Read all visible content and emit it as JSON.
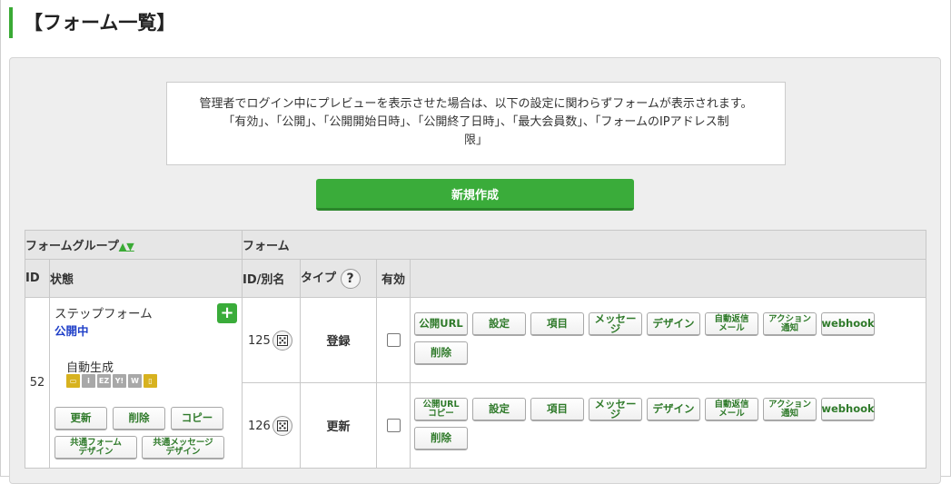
{
  "page": {
    "title": "【フォーム一覧】"
  },
  "notice": {
    "line1": "管理者でログイン中にプレビューを表示させた場合は、以下の設定に関わらずフォームが表示されます。",
    "line2": "「有効」、「公開」、「公開開始日時」、「公開終了日時」、「最大会員数」、「フォームのIPアドレス制",
    "line3": "限」"
  },
  "new_button": {
    "label": "新規作成"
  },
  "table": {
    "group_header": "フォームグループ",
    "sort_icon": "▲▼",
    "form_header": "フォーム",
    "columns": {
      "id": "ID",
      "status": "状態",
      "alias": "ID/別名",
      "type": "タイプ",
      "help": "?",
      "enabled": "有効"
    }
  },
  "group": {
    "id": "52",
    "name": "ステップフォーム",
    "status": "公開中",
    "add_icon": "+",
    "auto_label": "自動生成",
    "device_icons": [
      "pc-icon",
      "i-icon",
      "ez-icon",
      "yahoo-icon",
      "w-icon",
      "mobile-icon"
    ],
    "device_letters": [
      "▭",
      "i",
      "EZ",
      "Y!",
      "W",
      "▯"
    ],
    "buttons": {
      "update": "更新",
      "delete": "削除",
      "copy": "コピー",
      "common_form_design_1": "共通フォーム",
      "common_form_design_2": "デザイン",
      "common_msg_design_1": "共通メッセージ",
      "common_msg_design_2": "デザイン"
    }
  },
  "forms": [
    {
      "id": "125",
      "type": "登録",
      "enabled": false,
      "actions": {
        "public_url": "公開URL",
        "settings": "設定",
        "items": "項目",
        "message": "メッセージ",
        "design": "デザイン",
        "auto_reply_1": "自動返信",
        "auto_reply_2": "メール",
        "action_notice_1": "アクション",
        "action_notice_2": "通知",
        "webhook": "webhook",
        "delete": "削除"
      }
    },
    {
      "id": "126",
      "type": "更新",
      "enabled": false,
      "actions": {
        "public_url_copy_1": "公開URL",
        "public_url_copy_2": "コピー",
        "settings": "設定",
        "items": "項目",
        "message": "メッセージ",
        "design": "デザイン",
        "auto_reply_1": "自動返信",
        "auto_reply_2": "メール",
        "action_notice_1": "アクション",
        "action_notice_2": "通知",
        "webhook": "webhook",
        "delete": "削除"
      }
    }
  ],
  "colors": {
    "accent": "#3aac3a",
    "status_blue": "#1f3fc8",
    "button_text": "#2f7a2a"
  }
}
